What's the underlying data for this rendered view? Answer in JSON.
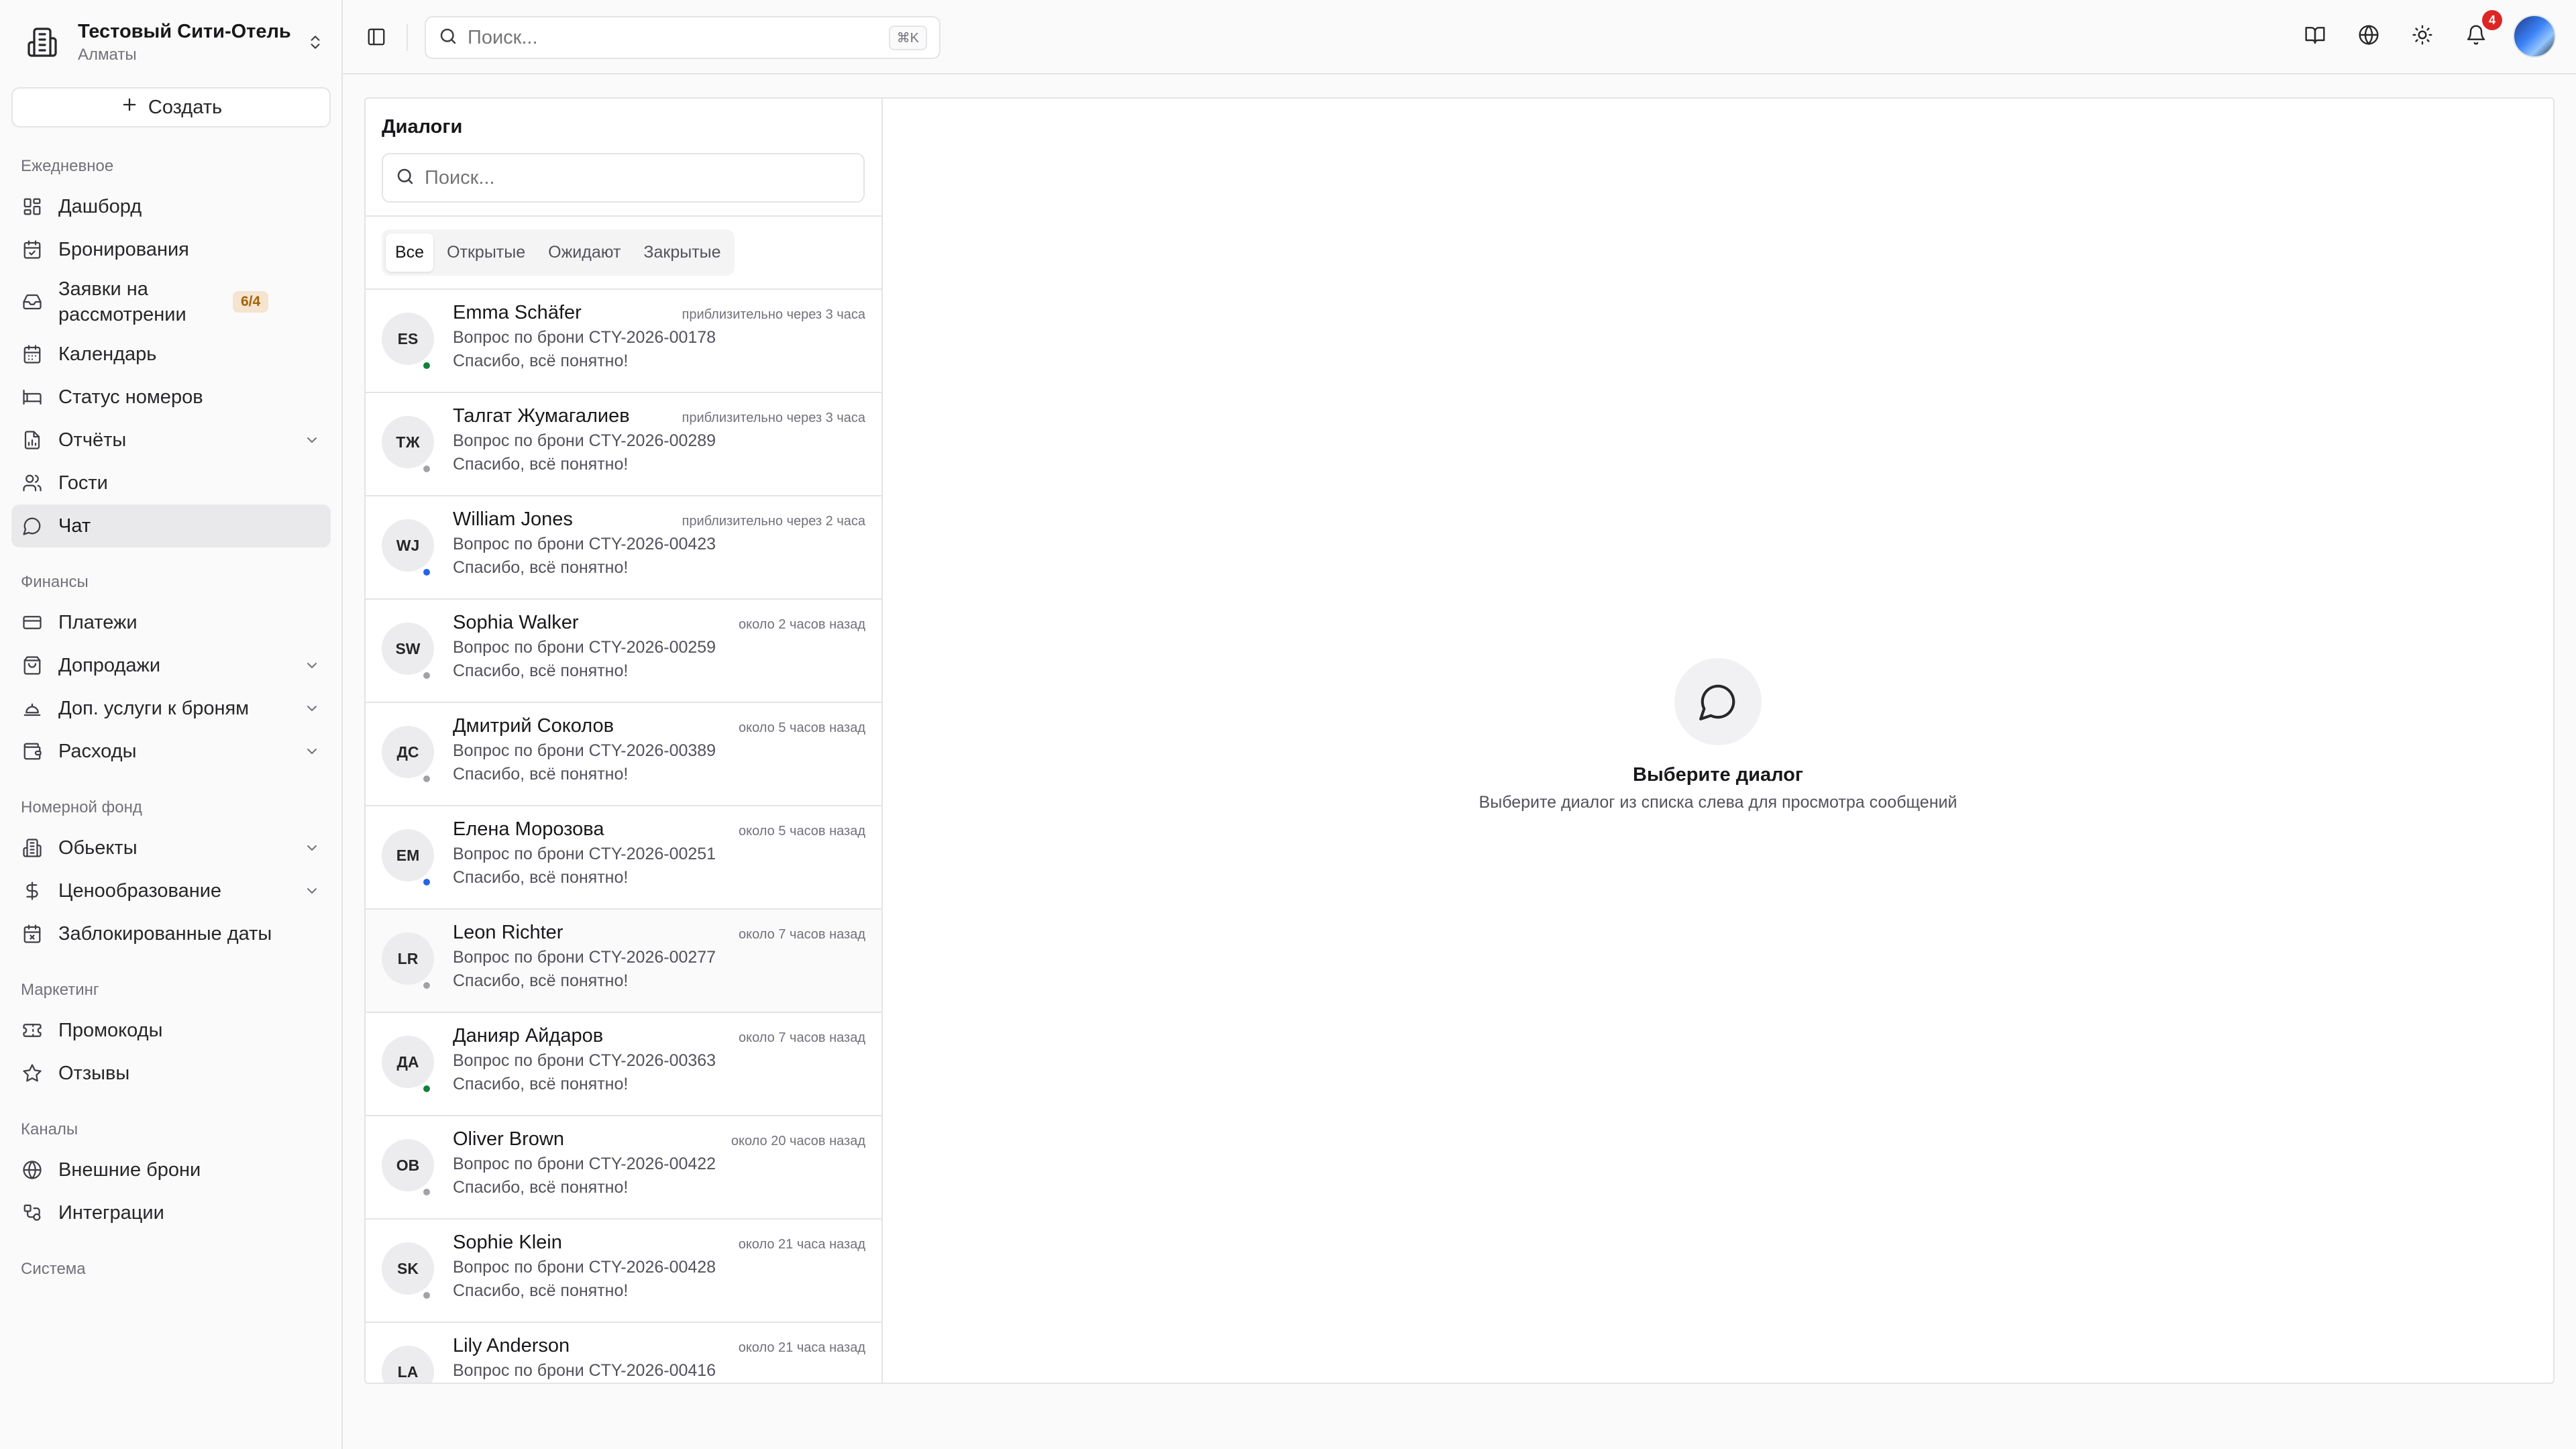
{
  "org": {
    "name": "Тестовый Сити-Отель",
    "city": "Алматы"
  },
  "create_label": "Создать",
  "nav": {
    "groups": [
      {
        "label": "Ежедневное",
        "items": [
          {
            "label": "Дашборд",
            "icon": "dashboard-icon"
          },
          {
            "label": "Бронирования",
            "icon": "calendar-check-icon"
          },
          {
            "label": "Заявки на рассмотрении",
            "icon": "inbox-icon",
            "badge": "6/4"
          },
          {
            "label": "Календарь",
            "icon": "calendar-icon"
          },
          {
            "label": "Статус номеров",
            "icon": "bed-icon"
          },
          {
            "label": "Отчёты",
            "icon": "report-icon",
            "expandable": true
          },
          {
            "label": "Гости",
            "icon": "users-icon"
          },
          {
            "label": "Чат",
            "icon": "chat-icon",
            "active": true
          }
        ]
      },
      {
        "label": "Финансы",
        "items": [
          {
            "label": "Платежи",
            "icon": "credit-card-icon"
          },
          {
            "label": "Допродажи",
            "icon": "shopping-bag-icon",
            "expandable": true
          },
          {
            "label": "Доп. услуги к броням",
            "icon": "service-bell-icon",
            "expandable": true
          },
          {
            "label": "Расходы",
            "icon": "wallet-icon",
            "expandable": true
          }
        ]
      },
      {
        "label": "Номерной фонд",
        "items": [
          {
            "label": "Обьекты",
            "icon": "building-icon",
            "expandable": true
          },
          {
            "label": "Ценообразование",
            "icon": "dollar-icon",
            "expandable": true
          },
          {
            "label": "Заблокированные даты",
            "icon": "calendar-x-icon"
          }
        ]
      },
      {
        "label": "Маркетинг",
        "items": [
          {
            "label": "Промокоды",
            "icon": "ticket-icon"
          },
          {
            "label": "Отзывы",
            "icon": "star-icon"
          }
        ]
      },
      {
        "label": "Каналы",
        "items": [
          {
            "label": "Внешние брони",
            "icon": "globe-icon"
          },
          {
            "label": "Интеграции",
            "icon": "integrations-icon"
          }
        ]
      },
      {
        "label": "Система",
        "items": []
      }
    ]
  },
  "topbar": {
    "search_placeholder": "Поиск...",
    "shortcut": "⌘K",
    "notifications_count": "4"
  },
  "dialogs": {
    "title": "Диалоги",
    "search_placeholder": "Поиск...",
    "tabs": [
      "Все",
      "Открытые",
      "Ожидают",
      "Закрытые"
    ],
    "active_tab": 0,
    "items": [
      {
        "initials": "ES",
        "name": "Emma Schäfer",
        "time": "приблизительно через 3 часа",
        "subject": "Вопрос по брони CTY-2026-00178",
        "message": "Спасибо, всё понятно!",
        "status_color": "#15803d"
      },
      {
        "initials": "ТЖ",
        "name": "Талгат Жумагалиев",
        "time": "приблизительно через 3 часа",
        "subject": "Вопрос по брони CTY-2026-00289",
        "message": "Спасибо, всё понятно!",
        "status_color": "#a1a1aa"
      },
      {
        "initials": "WJ",
        "name": "William Jones",
        "time": "приблизительно через 2 часа",
        "subject": "Вопрос по брони CTY-2026-00423",
        "message": "Спасибо, всё понятно!",
        "status_color": "#2563eb"
      },
      {
        "initials": "SW",
        "name": "Sophia Walker",
        "time": "около 2 часов назад",
        "subject": "Вопрос по брони CTY-2026-00259",
        "message": "Спасибо, всё понятно!",
        "status_color": "#a1a1aa"
      },
      {
        "initials": "ДС",
        "name": "Дмитрий Соколов",
        "time": "около 5 часов назад",
        "subject": "Вопрос по брони CTY-2026-00389",
        "message": "Спасибо, всё понятно!",
        "status_color": "#a1a1aa"
      },
      {
        "initials": "ЕМ",
        "name": "Елена Морозова",
        "time": "около 5 часов назад",
        "subject": "Вопрос по брони CTY-2026-00251",
        "message": "Спасибо, всё понятно!",
        "status_color": "#2563eb"
      },
      {
        "initials": "LR",
        "name": "Leon Richter",
        "time": "около 7 часов назад",
        "subject": "Вопрос по брони CTY-2026-00277",
        "message": "Спасибо, всё понятно!",
        "status_color": "#a1a1aa"
      },
      {
        "initials": "ДА",
        "name": "Данияр Айдаров",
        "time": "около 7 часов назад",
        "subject": "Вопрос по брони CTY-2026-00363",
        "message": "Спасибо, всё понятно!",
        "status_color": "#15803d"
      },
      {
        "initials": "OB",
        "name": "Oliver Brown",
        "time": "около 20 часов назад",
        "subject": "Вопрос по брони CTY-2026-00422",
        "message": "Спасибо, всё понятно!",
        "status_color": "#a1a1aa"
      },
      {
        "initials": "SK",
        "name": "Sophie Klein",
        "time": "около 21 часа назад",
        "subject": "Вопрос по брони CTY-2026-00428",
        "message": "Спасибо, всё понятно!",
        "status_color": "#a1a1aa"
      },
      {
        "initials": "LA",
        "name": "Lily Anderson",
        "time": "около 21 часа назад",
        "subject": "Вопрос по брони CTY-2026-00416",
        "message": "",
        "status_color": "#a1a1aa"
      }
    ]
  },
  "empty_state": {
    "title": "Выберите диалог",
    "subtitle": "Выберите диалог из списка слева для просмотра сообщений"
  }
}
